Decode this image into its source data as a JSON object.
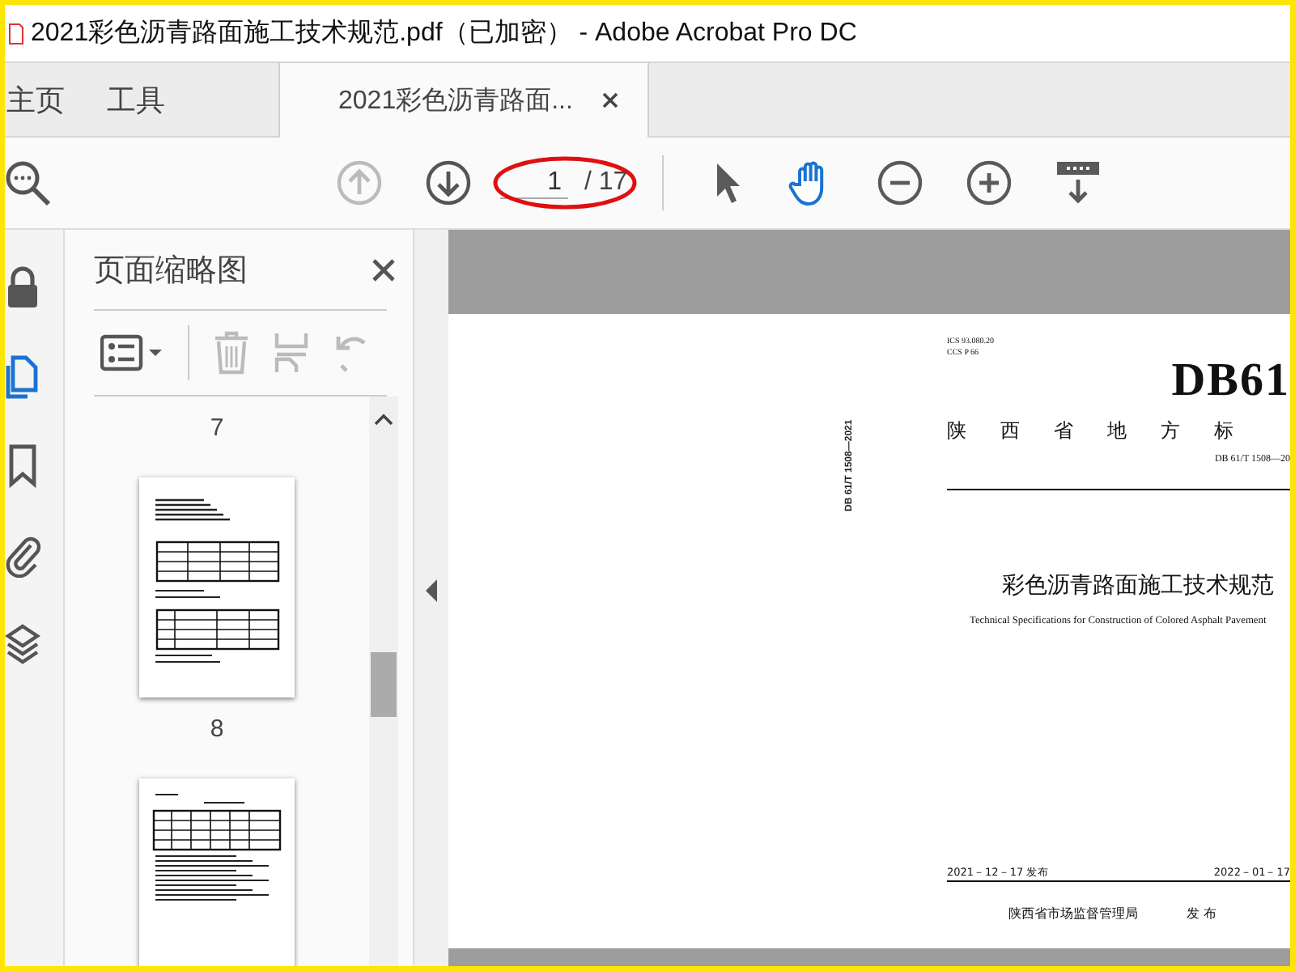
{
  "window": {
    "title": "2021彩色沥青路面施工技术规范.pdf（已加密） - Adobe Acrobat Pro DC"
  },
  "tabs": [
    {
      "label": "主页",
      "kind": "nav",
      "selected": false
    },
    {
      "label": "工具",
      "kind": "nav",
      "selected": false
    },
    {
      "label": "2021彩色沥青路面...",
      "kind": "document",
      "selected": true
    }
  ],
  "toolbar": {
    "nav": [
      {
        "kind": "prev",
        "disabled": true
      },
      {
        "kind": "next",
        "disabled": false
      }
    ],
    "page_number": {
      "value": "1"
    },
    "page_total": "/ 17",
    "tools": [
      {
        "kind": "select",
        "selected": false
      },
      {
        "kind": "hand",
        "selected": true
      },
      {
        "kind": "zoom_out",
        "selected": false
      },
      {
        "kind": "zoom_in",
        "selected": false
      },
      {
        "kind": "more",
        "selected": false
      }
    ]
  },
  "sidebar": {
    "items": [
      {
        "kind": "lock",
        "selected": false
      },
      {
        "kind": "pages",
        "selected": true
      },
      {
        "kind": "bookmark",
        "selected": false
      },
      {
        "kind": "attachment",
        "selected": false
      },
      {
        "kind": "layers",
        "selected": false
      }
    ]
  },
  "thumbnails": {
    "title": "页面缩略图",
    "tools": [
      {
        "kind": "options",
        "disabled": false
      },
      {
        "kind": "delete",
        "disabled": true
      },
      {
        "kind": "extract",
        "disabled": true
      },
      {
        "kind": "rotate",
        "disabled": true
      }
    ],
    "items": [
      {
        "label": "7"
      },
      {
        "label": "8"
      }
    ]
  },
  "document": {
    "side_code": "DB 61/T 1508—2021",
    "ics": "ICS 93.080.20",
    "ccs": "CCS P 66",
    "code": "DB61",
    "authority": "陕西省地方标",
    "number": "DB 61/T 1508—20",
    "title": "彩色沥青路面施工技术规范",
    "title_en": "Technical Specifications for Construction of Colored Asphalt Pavement",
    "issue_date": "2021－12－17 发布",
    "effective_date": "2022－01－17",
    "issuer": "陕西省市场监督管理局",
    "issued": "发 布"
  }
}
